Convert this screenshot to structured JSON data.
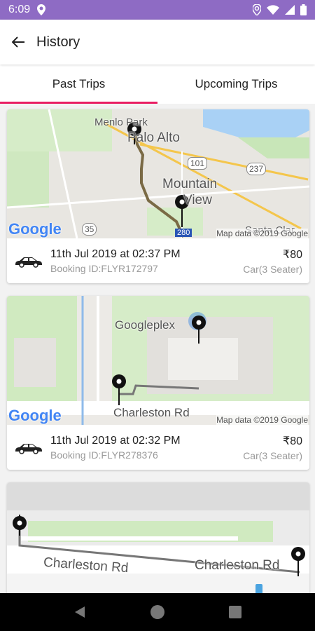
{
  "status": {
    "time": "6:09"
  },
  "header": {
    "title": "History"
  },
  "tabs": [
    {
      "label": "Past Trips"
    },
    {
      "label": "Upcoming Trips"
    }
  ],
  "trips": [
    {
      "date": "11th Jul 2019 at 02:37 PM",
      "booking": "Booking ID:FLYR172797",
      "price": "₹80",
      "type": "Car(3 Seater)",
      "map": {
        "labels": [
          "Menlo Park",
          "Palo Alto",
          "Mountain",
          "View",
          "101",
          "237",
          "35",
          "280",
          "Santa Clar"
        ],
        "google": "Google",
        "mapdata": "Map data ©2019 Google"
      }
    },
    {
      "date": "11th Jul 2019 at 02:32 PM",
      "booking": "Booking ID:FLYR278376",
      "price": "₹80",
      "type": "Car(3 Seater)",
      "map": {
        "labels": [
          "Googleplex",
          "Charleston Rd"
        ],
        "google": "Google",
        "mapdata": "Map data ©2019 Google"
      }
    },
    {
      "map": {
        "labels": [
          "Charleston Rd",
          "Charleston Rd"
        ]
      }
    }
  ],
  "colors": {
    "accent": "#e91e63",
    "status_bar": "#8e6bc4",
    "route": "#7a6a45"
  }
}
